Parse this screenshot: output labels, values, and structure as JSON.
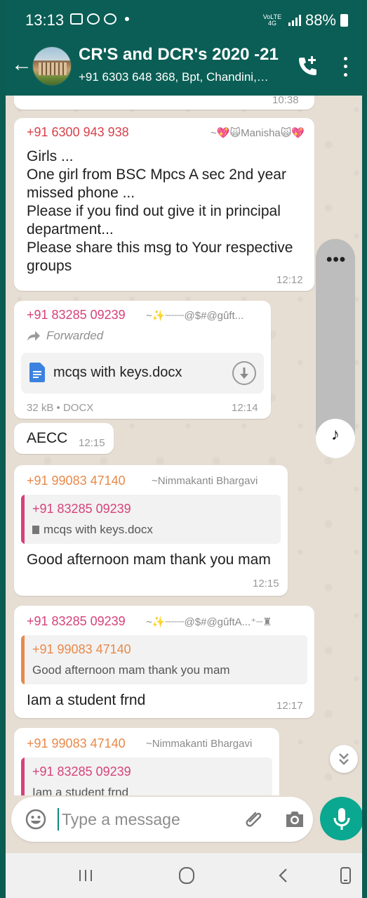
{
  "status_bar": {
    "time": "13:13",
    "network_label": "VoLTE 4G",
    "battery": "88%"
  },
  "header": {
    "back_icon": "arrow-left-icon",
    "title": "CR'S and DCR's 2020 -21",
    "subtitle": "+91 6303 648 368, Bpt, Chandini, Eloit..."
  },
  "messages": {
    "m0": {
      "time": "10:38"
    },
    "m1": {
      "sender": "+91 6300 943 938",
      "alias": "~💖🙀Manisha🙀💖",
      "text": "Girls ...\nOne girl from BSC Mpcs A sec 2nd year missed phone ...\nPlease if you find out give it in principal department...\nPlease share this msg to Your respective groups",
      "time": "12:12"
    },
    "m2": {
      "sender": "+91 83285 09239",
      "alias": "~✨┈┈┈@$#@gûft...",
      "forwarded": "Forwarded",
      "file_name": "mcqs with keys.docx",
      "file_meta": "32 kB • DOCX",
      "time": "12:14"
    },
    "m3": {
      "text": "AECC",
      "time": "12:15"
    },
    "m4": {
      "sender": "+91 99083 47140",
      "alias": "~Nimmakanti Bhargavi",
      "quote_sender": "+91 83285 09239",
      "quote_text": "mcqs with keys.docx",
      "text": "Good afternoon mam thank you mam",
      "time": "12:15"
    },
    "m5": {
      "sender": "+91 83285 09239",
      "alias": "~✨┈┈┈@$#@gûftA...⁺┈♜",
      "quote_sender": "+91 99083 47140",
      "quote_text": "Good afternoon mam thank you mam",
      "text": "Iam a student frnd",
      "time": "12:17"
    },
    "m6": {
      "sender": "+91 99083 47140",
      "alias": "~Nimmakanti Bhargavi",
      "quote_sender": "+91 83285 09239",
      "quote_text": "Iam a student frnd"
    }
  },
  "scroll_indicator": {
    "menu": "•••",
    "music_icon": "♪"
  },
  "composer": {
    "placeholder": "Type a message"
  },
  "colors": {
    "header": "#0a5e55",
    "sender_red": "#d8414a",
    "sender_pink": "#d6427a",
    "sender_orange": "#e8894a",
    "mic_button": "#0aa890"
  }
}
